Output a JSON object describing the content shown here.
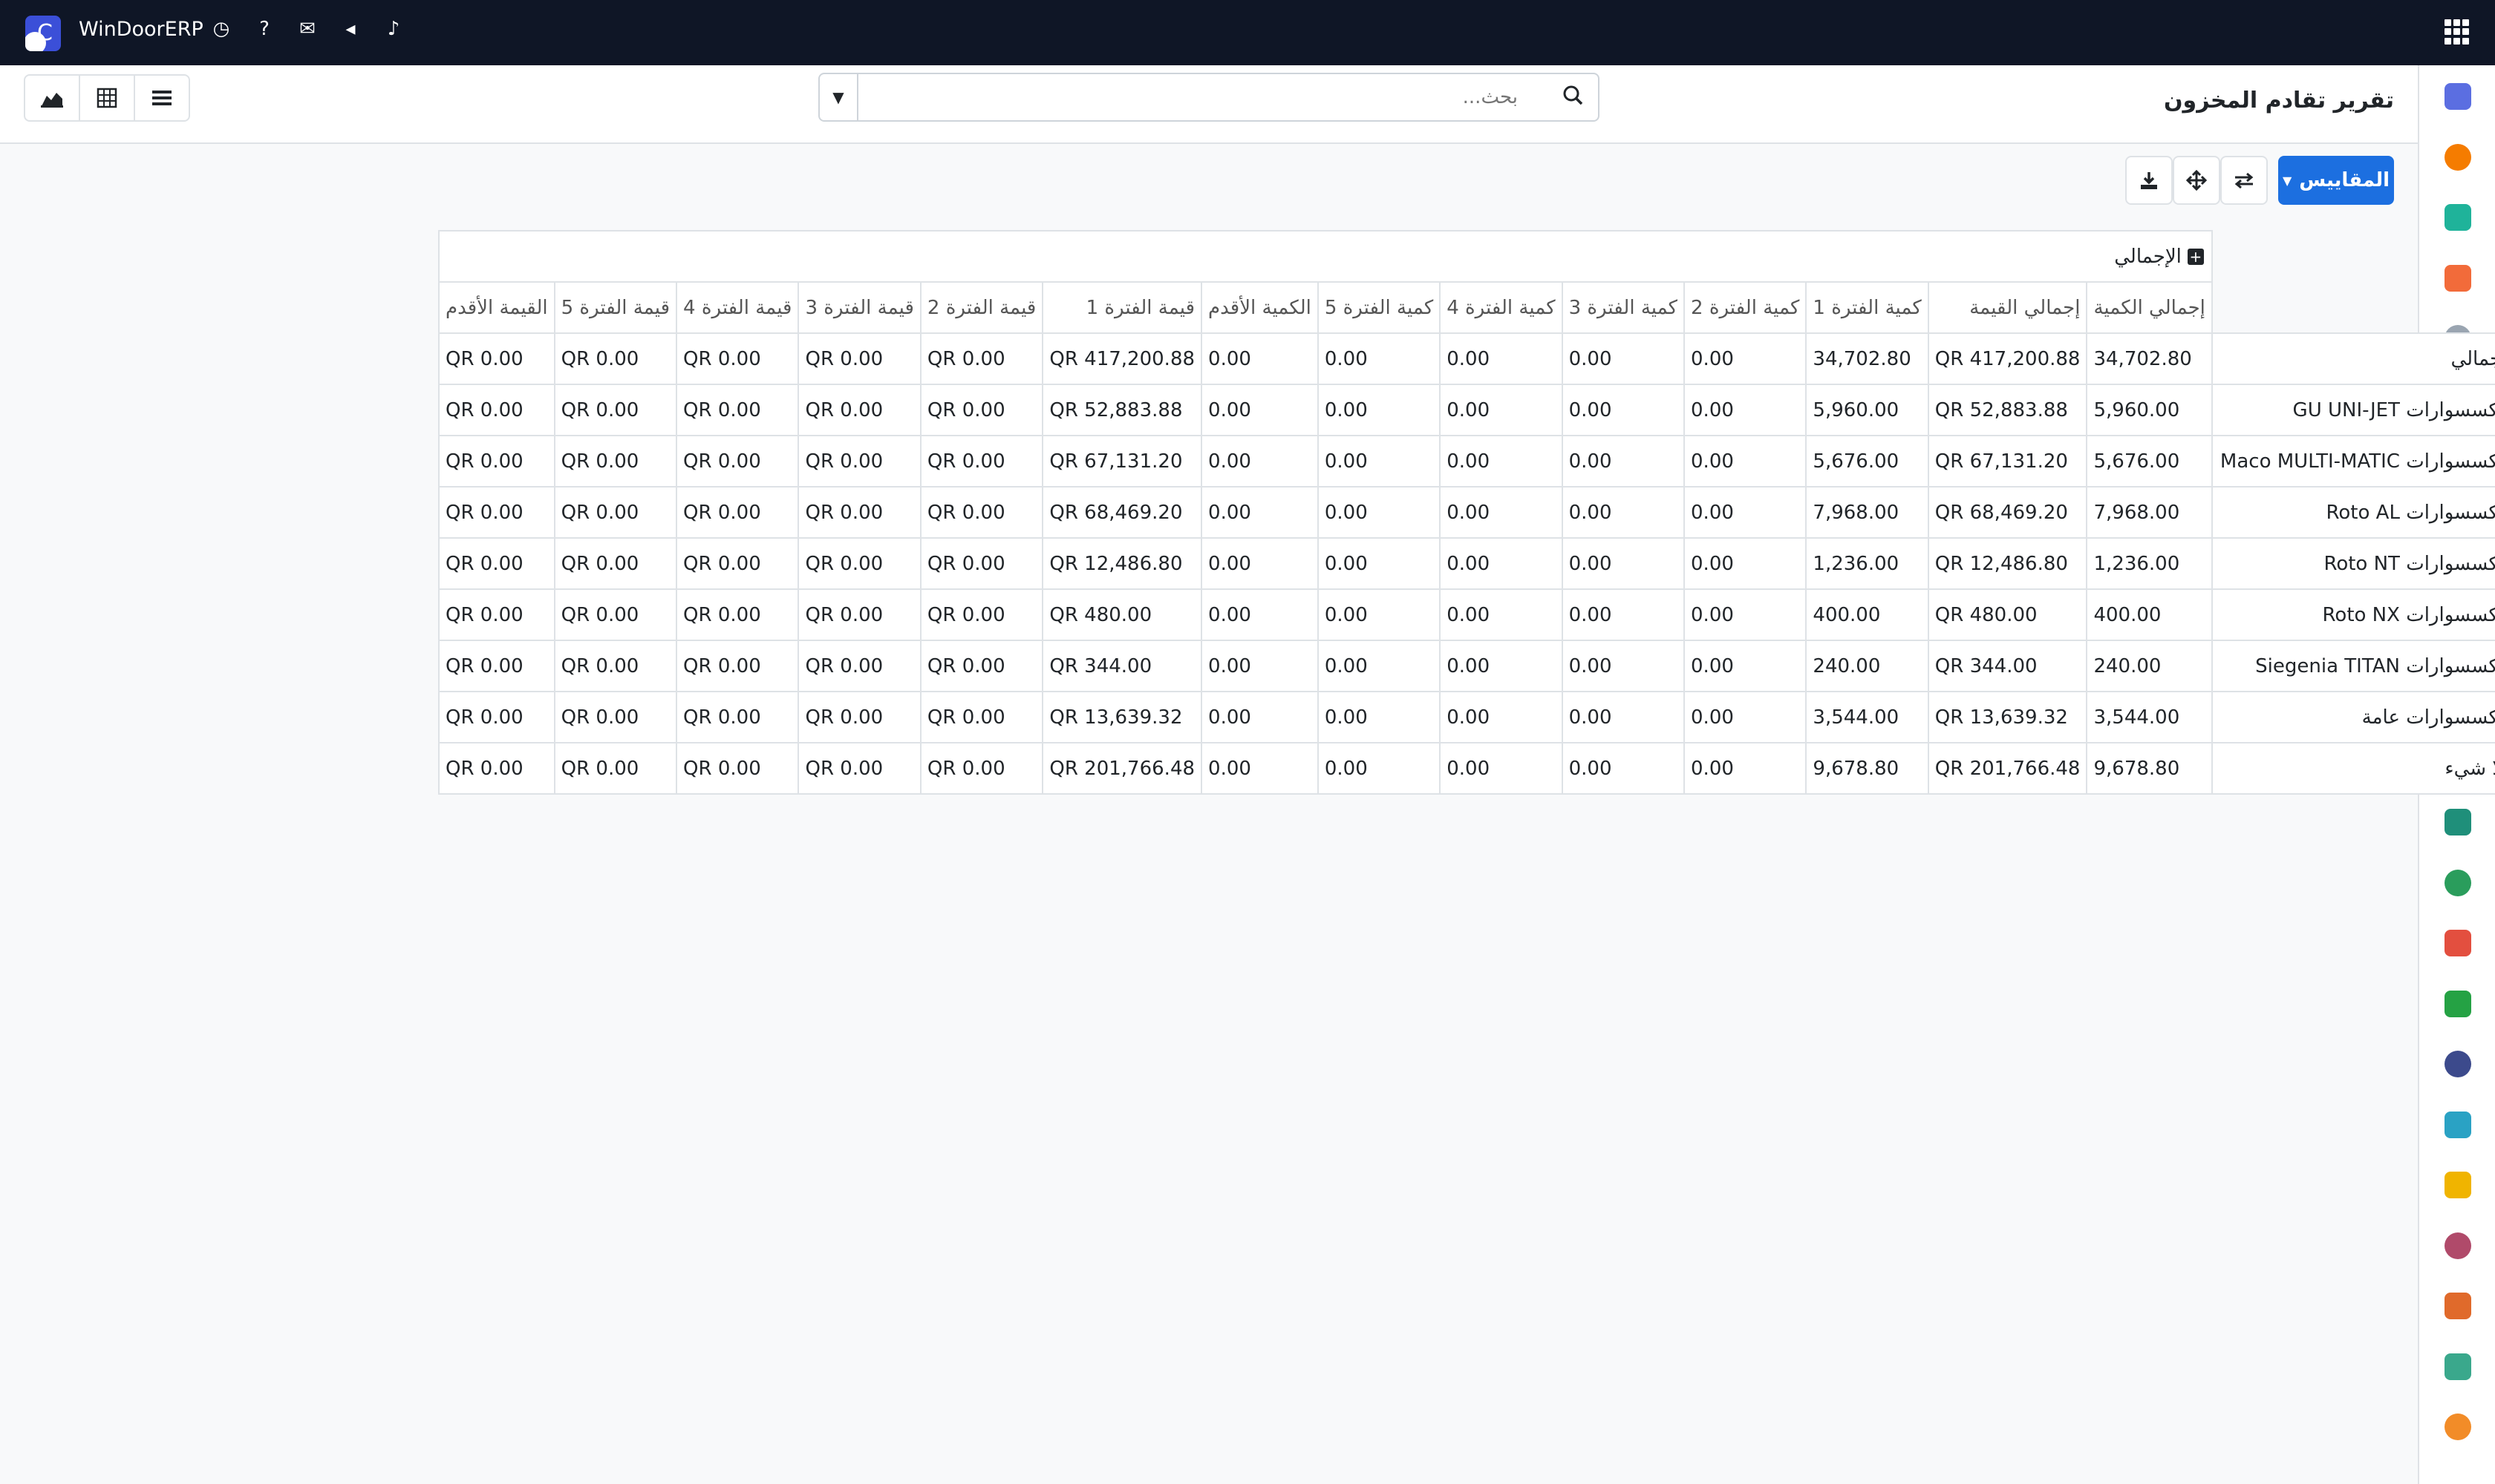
{
  "navbar": {
    "brand": "WinDoorERP",
    "icons": [
      "clock-icon",
      "question-circle-icon",
      "comments-icon",
      "bullhorn-icon",
      "bell-icon"
    ]
  },
  "control": {
    "title": "تقرير تقادم المخزون",
    "search_placeholder": "بحث..."
  },
  "buttons": {
    "measures": "المقاييس"
  },
  "pivot": {
    "col_group_header": "الإجمالي",
    "columns": [
      "إجمالي الكمية",
      "إجمالي القيمة",
      "كمية الفترة 1",
      "كمية الفترة 2",
      "كمية الفترة 3",
      "كمية الفترة 4",
      "كمية الفترة 5",
      "الكمية الأقدم",
      "قيمة الفترة 1",
      "قيمة الفترة 2",
      "قيمة الفترة 3",
      "قيمة الفترة 4",
      "قيمة الفترة 5",
      "القيمة الأقدم"
    ],
    "rows": [
      {
        "label": "الإجمالي",
        "values": [
          "34,702.80",
          "417,200.88 QR",
          "34,702.80",
          "0.00",
          "0.00",
          "0.00",
          "0.00",
          "0.00",
          "417,200.88 QR",
          "0.00 QR",
          "0.00 QR",
          "0.00 QR",
          "0.00 QR",
          "0.00 QR"
        ]
      },
      {
        "label": "إكسسوارات GU UNI-JET",
        "values": [
          "5,960.00",
          "52,883.88 QR",
          "5,960.00",
          "0.00",
          "0.00",
          "0.00",
          "0.00",
          "0.00",
          "52,883.88 QR",
          "0.00 QR",
          "0.00 QR",
          "0.00 QR",
          "0.00 QR",
          "0.00 QR"
        ]
      },
      {
        "label": "إكسسوارات Maco MULTI-MATIC",
        "values": [
          "5,676.00",
          "67,131.20 QR",
          "5,676.00",
          "0.00",
          "0.00",
          "0.00",
          "0.00",
          "0.00",
          "67,131.20 QR",
          "0.00 QR",
          "0.00 QR",
          "0.00 QR",
          "0.00 QR",
          "0.00 QR"
        ]
      },
      {
        "label": "إكسسوارات Roto AL",
        "values": [
          "7,968.00",
          "68,469.20 QR",
          "7,968.00",
          "0.00",
          "0.00",
          "0.00",
          "0.00",
          "0.00",
          "68,469.20 QR",
          "0.00 QR",
          "0.00 QR",
          "0.00 QR",
          "0.00 QR",
          "0.00 QR"
        ]
      },
      {
        "label": "إكسسوارات Roto NT",
        "values": [
          "1,236.00",
          "12,486.80 QR",
          "1,236.00",
          "0.00",
          "0.00",
          "0.00",
          "0.00",
          "0.00",
          "12,486.80 QR",
          "0.00 QR",
          "0.00 QR",
          "0.00 QR",
          "0.00 QR",
          "0.00 QR"
        ]
      },
      {
        "label": "إكسسوارات Roto NX",
        "values": [
          "400.00",
          "480.00 QR",
          "400.00",
          "0.00",
          "0.00",
          "0.00",
          "0.00",
          "0.00",
          "480.00 QR",
          "0.00 QR",
          "0.00 QR",
          "0.00 QR",
          "0.00 QR",
          "0.00 QR"
        ]
      },
      {
        "label": "إكسسوارات Siegenia TITAN",
        "values": [
          "240.00",
          "344.00 QR",
          "240.00",
          "0.00",
          "0.00",
          "0.00",
          "0.00",
          "0.00",
          "344.00 QR",
          "0.00 QR",
          "0.00 QR",
          "0.00 QR",
          "0.00 QR",
          "0.00 QR"
        ]
      },
      {
        "label": "إكسسوارات عامة",
        "values": [
          "3,544.00",
          "13,639.32 QR",
          "3,544.00",
          "0.00",
          "0.00",
          "0.00",
          "0.00",
          "0.00",
          "13,639.32 QR",
          "0.00 QR",
          "0.00 QR",
          "0.00 QR",
          "0.00 QR",
          "0.00 QR"
        ]
      },
      {
        "label": "لا شيء",
        "values": [
          "9,678.80",
          "201,766.48 QR",
          "9,678.80",
          "0.00",
          "0.00",
          "0.00",
          "0.00",
          "0.00",
          "201,766.48 QR",
          "0.00 QR",
          "0.00 QR",
          "0.00 QR",
          "0.00 QR",
          "0.00 QR"
        ]
      }
    ]
  },
  "rail_apps": [
    {
      "icon": "m-app-icon",
      "color": "#5b6ee1"
    },
    {
      "icon": "chat-bubble-icon",
      "color": "#f57c00"
    },
    {
      "icon": "diamond-icon",
      "color": "#1fb39a"
    },
    {
      "icon": "bar-chart-icon",
      "color": "#f26b3a"
    },
    {
      "icon": "cube-icon",
      "color": "#9aa5b1"
    },
    {
      "icon": "photo-icon",
      "color": "#f0a04b"
    },
    {
      "icon": "check-icon",
      "color": "#21a4a0"
    },
    {
      "icon": "book-icon",
      "color": "#3d5a9c"
    },
    {
      "icon": "box-icon",
      "color": "#7e57a0"
    },
    {
      "icon": "dollar-doc-icon",
      "color": "#2b8ad8"
    },
    {
      "icon": "people-icon",
      "color": "#e08a3c"
    },
    {
      "icon": "calendar-31-icon",
      "color": "#e5a13a"
    },
    {
      "icon": "pen-icon",
      "color": "#1f8f7a"
    },
    {
      "icon": "contacts-icon",
      "color": "#2a9d5c"
    },
    {
      "icon": "dashboard-icon",
      "color": "#e34f3f"
    },
    {
      "icon": "whatsapp-icon",
      "color": "#25a244"
    },
    {
      "icon": "compass-icon",
      "color": "#3c4a8c"
    },
    {
      "icon": "wave-icon",
      "color": "#2aa2c4"
    },
    {
      "icon": "paper-plane-icon",
      "color": "#f0b400"
    },
    {
      "icon": "layers-icon",
      "color": "#b04a6a"
    },
    {
      "icon": "hexagon-icon",
      "color": "#e06a2b"
    },
    {
      "icon": "pie-icon",
      "color": "#3aa88c"
    },
    {
      "icon": "gear-box-icon",
      "color": "#f28c28"
    }
  ]
}
